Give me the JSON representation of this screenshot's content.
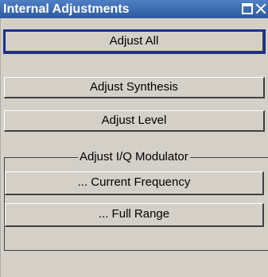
{
  "window": {
    "title": "Internal Adjustments"
  },
  "buttons": {
    "adjust_all": "Adjust All",
    "adjust_synthesis": "Adjust Synthesis",
    "adjust_level": "Adjust Level"
  },
  "iq_group": {
    "title": "Adjust I/Q Modulator",
    "current_frequency": "... Current Frequency",
    "full_range": "... Full Range"
  },
  "icons": {
    "maximize": "maximize-icon",
    "close": "close-icon"
  }
}
